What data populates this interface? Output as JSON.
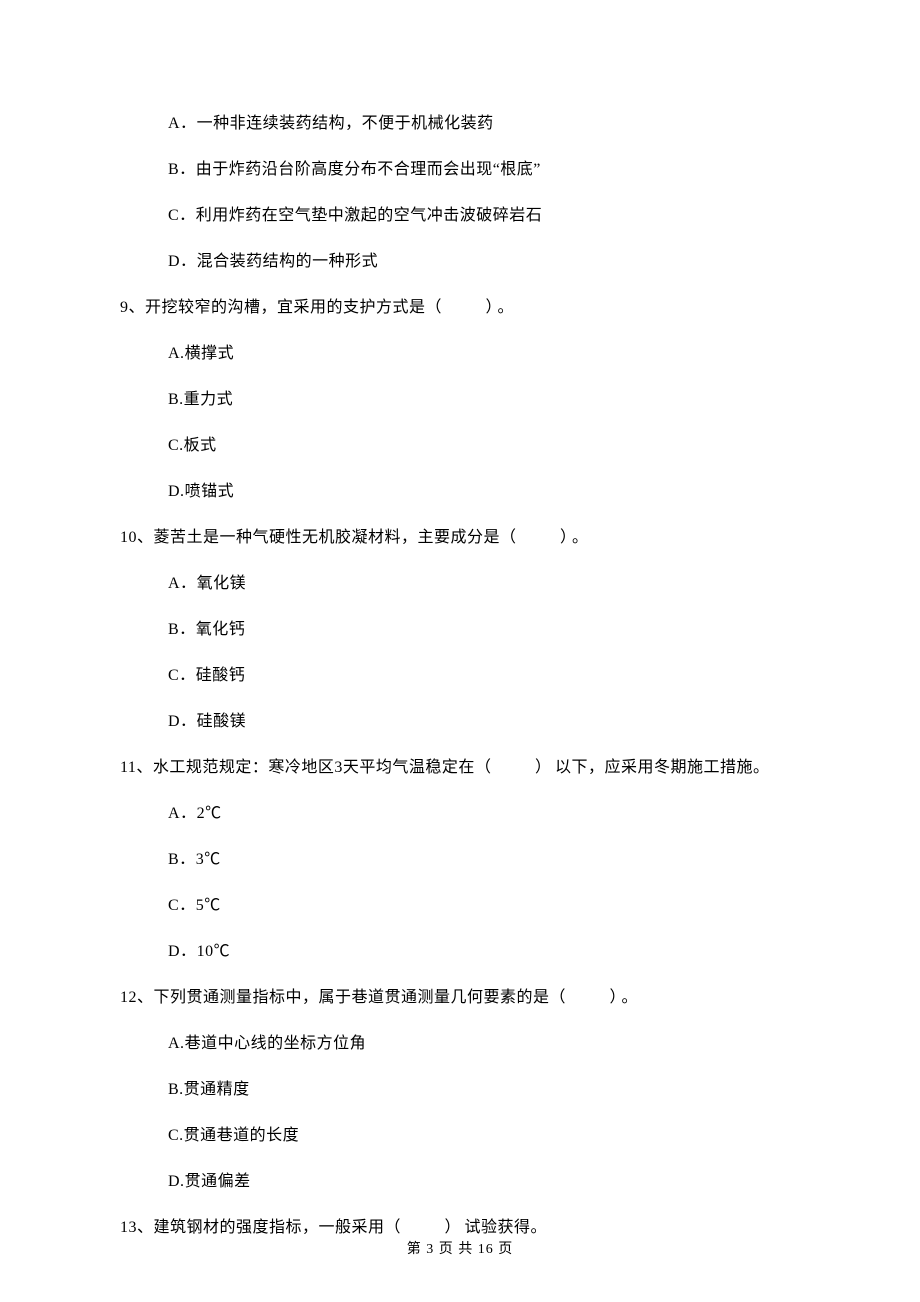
{
  "blank": "（　　）",
  "items": [
    {
      "type": "option",
      "label": "A．",
      "text": "一种非连续装药结构，不便于机械化装药"
    },
    {
      "type": "option",
      "label": "B．",
      "text": "由于炸药沿台阶高度分布不合理而会出现“根底”"
    },
    {
      "type": "option",
      "label": "C．",
      "text": "利用炸药在空气垫中激起的空气冲击波破碎岩石"
    },
    {
      "type": "option",
      "label": "D．",
      "text": "混合装药结构的一种形式"
    },
    {
      "type": "question",
      "num": "9、",
      "before": "开挖较窄的沟槽，宜采用的支护方式是",
      "after": "。"
    },
    {
      "type": "option",
      "label": "A.",
      "text": "横撑式"
    },
    {
      "type": "option",
      "label": "B.",
      "text": "重力式"
    },
    {
      "type": "option",
      "label": "C.",
      "text": "板式"
    },
    {
      "type": "option",
      "label": "D.",
      "text": "喷锚式"
    },
    {
      "type": "question",
      "num": "10、",
      "before": "菱苦土是一种气硬性无机胶凝材料，主要成分是",
      "after": "。"
    },
    {
      "type": "option",
      "label": "A．",
      "text": "氧化镁"
    },
    {
      "type": "option",
      "label": "B．",
      "text": "氧化钙"
    },
    {
      "type": "option",
      "label": "C．",
      "text": "硅酸钙"
    },
    {
      "type": "option",
      "label": "D．",
      "text": "硅酸镁"
    },
    {
      "type": "question",
      "num": "11、",
      "before": "水工规范规定：寒冷地区3天平均气温稳定在",
      "after": "以下，应采用冬期施工措施。"
    },
    {
      "type": "option",
      "label": "A．",
      "text": "2℃"
    },
    {
      "type": "option",
      "label": "B．",
      "text": "3℃"
    },
    {
      "type": "option",
      "label": "C．",
      "text": "5℃"
    },
    {
      "type": "option",
      "label": "D．",
      "text": "10℃"
    },
    {
      "type": "question",
      "num": "12、",
      "before": "下列贯通测量指标中，属于巷道贯通测量几何要素的是",
      "after": "。"
    },
    {
      "type": "option",
      "label": "A.",
      "text": "巷道中心线的坐标方位角"
    },
    {
      "type": "option",
      "label": "B.",
      "text": "贯通精度"
    },
    {
      "type": "option",
      "label": "C.",
      "text": "贯通巷道的长度"
    },
    {
      "type": "option",
      "label": "D.",
      "text": "贯通偏差"
    },
    {
      "type": "question",
      "num": "13、",
      "before": "建筑钢材的强度指标，一般采用",
      "after": "试验获得。"
    }
  ],
  "footer": "第 3 页 共 16 页"
}
